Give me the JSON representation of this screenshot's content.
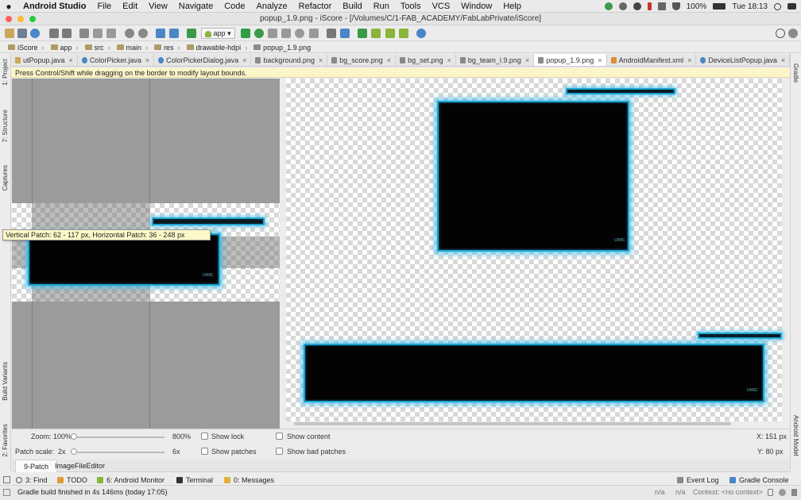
{
  "menubar": {
    "apple": "",
    "app_name": "Android Studio",
    "items": [
      "File",
      "Edit",
      "View",
      "Navigate",
      "Code",
      "Analyze",
      "Refactor",
      "Build",
      "Run",
      "Tools",
      "VCS",
      "Window",
      "Help"
    ],
    "battery": "100%",
    "clock": "Tue 18:13"
  },
  "window": {
    "title": "popup_1.9.png - iScore - [/Volumes/C/1-FAB_ACADEMY/FabLabPrivate/iScore]"
  },
  "toolbar": {
    "run_config": "app"
  },
  "breadcrumb": [
    "iScore",
    "app",
    "src",
    "main",
    "res",
    "drawable-hdpi",
    "popup_1.9.png"
  ],
  "tabs": [
    {
      "label": "utPopup.java",
      "type": "java"
    },
    {
      "label": "ColorPicker.java",
      "type": "class"
    },
    {
      "label": "ColorPickerDialog.java",
      "type": "class"
    },
    {
      "label": "background.png",
      "type": "image"
    },
    {
      "label": "bg_score.png",
      "type": "image"
    },
    {
      "label": "bg_set.png",
      "type": "image"
    },
    {
      "label": "bg_team_l.9.png",
      "type": "image"
    },
    {
      "label": "popup_1.9.png",
      "type": "image",
      "active": true
    },
    {
      "label": "AndroidManifest.xml",
      "type": "xml"
    },
    {
      "label": "DeviceListPopup.java",
      "type": "class"
    }
  ],
  "hint": "Press Control/Shift while dragging on the border to modify layout bounds.",
  "left_tools": [
    "1: Project",
    "7: Structure",
    "Captures",
    "Build Variants",
    "2: Favorites"
  ],
  "right_tools": [
    "Gradle",
    "Android Model"
  ],
  "tooltip": "Vertical Patch: 62 - 117 px, Horizontal Patch: 36 - 248 px",
  "controls": {
    "zoom_label": "Zoom: 100%",
    "zoom_max": "800%",
    "zoom_value": 0,
    "patch_scale_label": "Patch scale:",
    "patch_scale_min": "2x",
    "patch_scale_max": "6x",
    "patch_scale_value": 0,
    "show_lock": "Show lock",
    "show_patches": "Show patches",
    "show_content": "Show content",
    "show_bad_patches": "Show bad patches",
    "x_readout": "X: 151 px",
    "y_readout": "Y: 80 px"
  },
  "bottom_tabs": [
    "9-Patch",
    "ImageFileEditor"
  ],
  "tool_windows": {
    "find": "3: Find",
    "todo": "TODO",
    "android_monitor": "6: Android Monitor",
    "terminal": "Terminal",
    "messages": "0: Messages",
    "event_log": "Event Log",
    "gradle_console": "Gradle Console"
  },
  "status": {
    "message": "Gradle build finished in 4s 146ms (today 17:05)",
    "na1": "n/a",
    "na2": "n/a",
    "context": "Context: <no context>"
  },
  "frame_logo": "UNIIC",
  "colors": {
    "glow": "#1aa6d2",
    "hint_bg": "#fcf5c8",
    "tooltip_bg": "#fdf8c8"
  }
}
